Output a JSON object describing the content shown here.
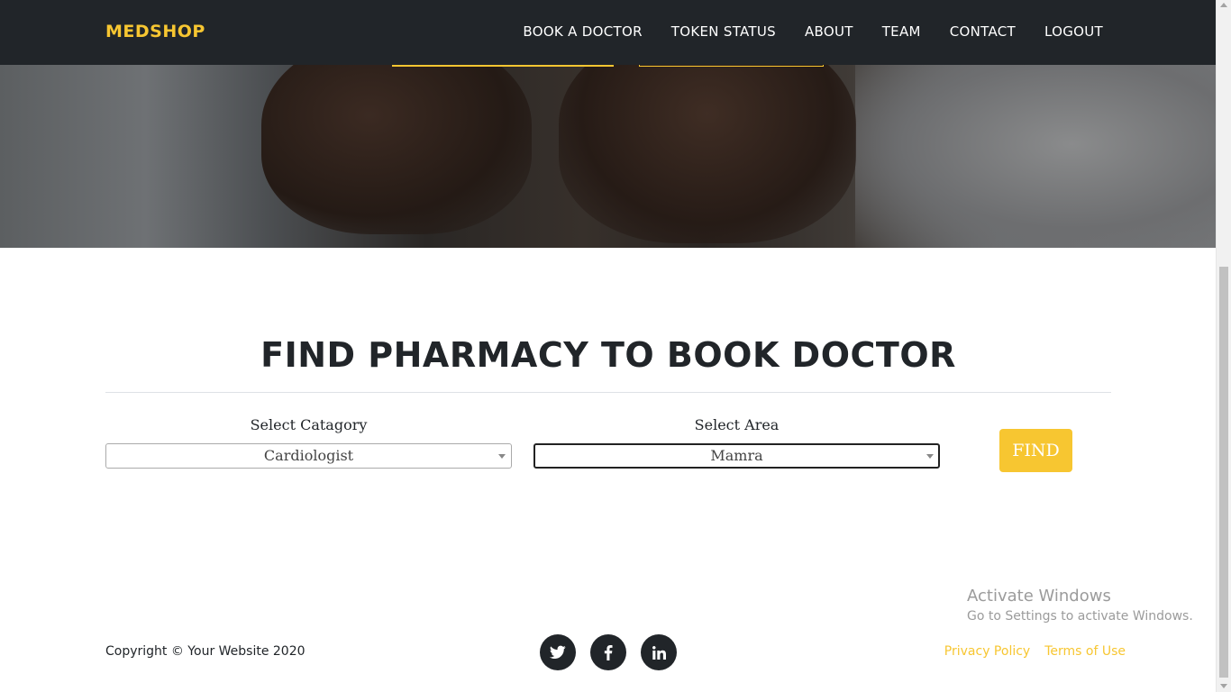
{
  "brand": {
    "name": "MEDSHOP",
    "color": "#f7c631"
  },
  "nav": {
    "items": [
      {
        "label": "BOOK A DOCTOR"
      },
      {
        "label": "TOKEN STATUS"
      },
      {
        "label": "ABOUT"
      },
      {
        "label": "TEAM"
      },
      {
        "label": "CONTACT"
      },
      {
        "label": "LOGOUT"
      }
    ]
  },
  "main": {
    "title": "FIND PHARMACY TO BOOK DOCTOR",
    "category": {
      "label": "Select Catagory",
      "selected": "Cardiologist"
    },
    "area": {
      "label": "Select Area",
      "selected": "Mamra"
    },
    "find_label": "FIND"
  },
  "watermark": {
    "title": "Activate Windows",
    "subtitle": "Go to Settings to activate Windows."
  },
  "footer": {
    "copyright": "Copyright © Your Website 2020",
    "social_icons": [
      "twitter-icon",
      "facebook-icon",
      "linkedin-icon"
    ],
    "links": [
      {
        "label": "Privacy Policy"
      },
      {
        "label": "Terms of Use"
      }
    ]
  },
  "colors": {
    "accent": "#f7c631",
    "navbar": "#212529",
    "text": "#212529"
  }
}
